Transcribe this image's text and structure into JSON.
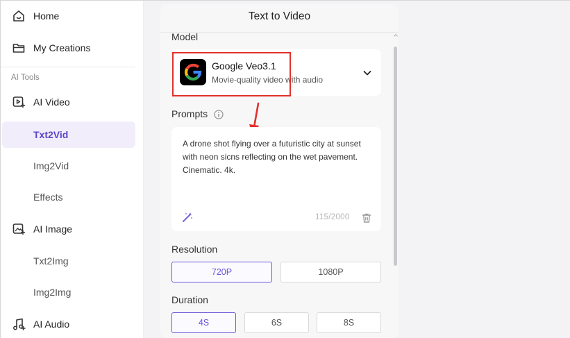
{
  "sidebar": {
    "home": "Home",
    "my_creations": "My Creations",
    "section_label": "AI Tools",
    "ai_video": "AI Video",
    "txt2vid": "Txt2Vid",
    "img2vid": "Img2Vid",
    "effects": "Effects",
    "ai_image": "AI Image",
    "txt2img": "Txt2Img",
    "img2img": "Img2Img",
    "ai_audio": "AI Audio"
  },
  "panel": {
    "title": "Text to Video",
    "model": {
      "label": "Model",
      "name": "Google Veo3.1",
      "description": "Movie-quality video with audio"
    },
    "prompts": {
      "label": "Prompts",
      "text": "A drone shot flying over a futuristic city at sunset with neon sicns reflecting on the wet pavement. Cinematic. 4k.",
      "counter": "115/2000"
    },
    "resolution": {
      "label": "Resolution",
      "options": [
        "720P",
        "1080P"
      ],
      "selected": "720P"
    },
    "duration": {
      "label": "Duration",
      "options": [
        "4S",
        "6S",
        "8S"
      ],
      "selected": "4S"
    }
  },
  "colors": {
    "accent": "#6b55d6",
    "active_bg": "#f1edfb",
    "annotation_red": "#e0322b"
  },
  "icons": [
    "home-icon",
    "folder-icon",
    "video-icon",
    "image-icon",
    "music-icon",
    "google-logo",
    "info-icon",
    "magic-wand-icon",
    "trash-icon",
    "chevron-down-icon"
  ]
}
